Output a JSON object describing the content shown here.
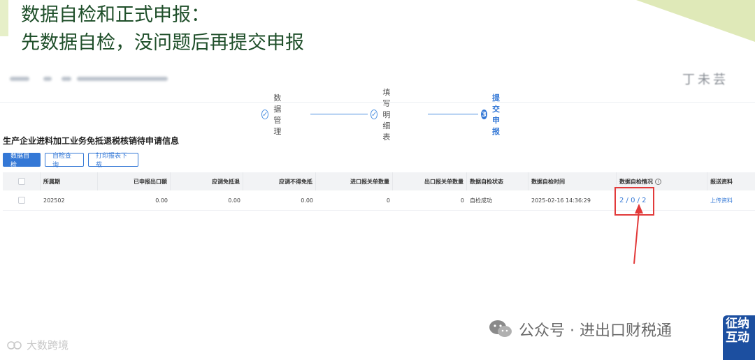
{
  "slide": {
    "title": "数据自检和正式申报：",
    "subtitle": "先数据自检，没问题后再提交申报"
  },
  "header": {
    "right_text_blurred": "丁未芸"
  },
  "stepper": {
    "steps": [
      {
        "number": "✓",
        "label": "数据管理",
        "state": "done"
      },
      {
        "number": "✓",
        "label": "填写明细表",
        "state": "done"
      },
      {
        "number": "3",
        "label": "提交申报",
        "state": "active"
      }
    ]
  },
  "page": {
    "title": "生产企业进料加工业务免抵退税核销待申请信息"
  },
  "toolbar": {
    "data_check": "数据自检",
    "check_query": "自检查询",
    "print_download": "打印报表下载"
  },
  "table": {
    "columns": [
      "",
      "所属期",
      "已申报出口额",
      "应调免抵退",
      "应调不得免抵",
      "进口报关单数量",
      "出口报关单数量",
      "数据自检状态",
      "数据自检时间",
      "数据自检情况",
      "报送资料"
    ],
    "rows": [
      {
        "period": "202502",
        "declared_export": "0.00",
        "adj_exempt_refund": "0.00",
        "adj_not_exempt": "0.00",
        "import_count": "0",
        "export_count": "0",
        "check_status": "自检成功",
        "check_time": "2025-02-16 14:36:29",
        "check_result": "2 / 0 / 2",
        "upload": "上传资料"
      }
    ]
  },
  "colors": {
    "accent": "#3478d6",
    "highlight": "#e23a3a",
    "slide_text": "#1f4f2a"
  },
  "watermarks": {
    "left": "大数跨境",
    "right": "公众号 · 进出口财税通",
    "mascot": "征纳互动"
  }
}
